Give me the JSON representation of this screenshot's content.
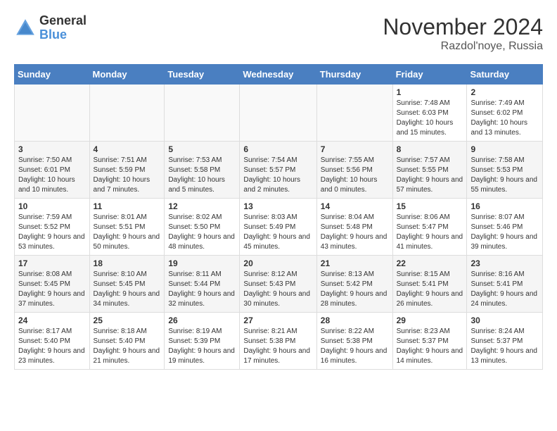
{
  "logo": {
    "general": "General",
    "blue": "Blue"
  },
  "title": "November 2024",
  "location": "Razdol'noye, Russia",
  "days_of_week": [
    "Sunday",
    "Monday",
    "Tuesday",
    "Wednesday",
    "Thursday",
    "Friday",
    "Saturday"
  ],
  "weeks": [
    [
      null,
      null,
      null,
      null,
      null,
      {
        "day": "1",
        "sunrise": "Sunrise: 7:48 AM",
        "sunset": "Sunset: 6:03 PM",
        "daylight": "Daylight: 10 hours and 15 minutes."
      },
      {
        "day": "2",
        "sunrise": "Sunrise: 7:49 AM",
        "sunset": "Sunset: 6:02 PM",
        "daylight": "Daylight: 10 hours and 13 minutes."
      }
    ],
    [
      {
        "day": "3",
        "sunrise": "Sunrise: 7:50 AM",
        "sunset": "Sunset: 6:01 PM",
        "daylight": "Daylight: 10 hours and 10 minutes."
      },
      {
        "day": "4",
        "sunrise": "Sunrise: 7:51 AM",
        "sunset": "Sunset: 5:59 PM",
        "daylight": "Daylight: 10 hours and 7 minutes."
      },
      {
        "day": "5",
        "sunrise": "Sunrise: 7:53 AM",
        "sunset": "Sunset: 5:58 PM",
        "daylight": "Daylight: 10 hours and 5 minutes."
      },
      {
        "day": "6",
        "sunrise": "Sunrise: 7:54 AM",
        "sunset": "Sunset: 5:57 PM",
        "daylight": "Daylight: 10 hours and 2 minutes."
      },
      {
        "day": "7",
        "sunrise": "Sunrise: 7:55 AM",
        "sunset": "Sunset: 5:56 PM",
        "daylight": "Daylight: 10 hours and 0 minutes."
      },
      {
        "day": "8",
        "sunrise": "Sunrise: 7:57 AM",
        "sunset": "Sunset: 5:55 PM",
        "daylight": "Daylight: 9 hours and 57 minutes."
      },
      {
        "day": "9",
        "sunrise": "Sunrise: 7:58 AM",
        "sunset": "Sunset: 5:53 PM",
        "daylight": "Daylight: 9 hours and 55 minutes."
      }
    ],
    [
      {
        "day": "10",
        "sunrise": "Sunrise: 7:59 AM",
        "sunset": "Sunset: 5:52 PM",
        "daylight": "Daylight: 9 hours and 53 minutes."
      },
      {
        "day": "11",
        "sunrise": "Sunrise: 8:01 AM",
        "sunset": "Sunset: 5:51 PM",
        "daylight": "Daylight: 9 hours and 50 minutes."
      },
      {
        "day": "12",
        "sunrise": "Sunrise: 8:02 AM",
        "sunset": "Sunset: 5:50 PM",
        "daylight": "Daylight: 9 hours and 48 minutes."
      },
      {
        "day": "13",
        "sunrise": "Sunrise: 8:03 AM",
        "sunset": "Sunset: 5:49 PM",
        "daylight": "Daylight: 9 hours and 45 minutes."
      },
      {
        "day": "14",
        "sunrise": "Sunrise: 8:04 AM",
        "sunset": "Sunset: 5:48 PM",
        "daylight": "Daylight: 9 hours and 43 minutes."
      },
      {
        "day": "15",
        "sunrise": "Sunrise: 8:06 AM",
        "sunset": "Sunset: 5:47 PM",
        "daylight": "Daylight: 9 hours and 41 minutes."
      },
      {
        "day": "16",
        "sunrise": "Sunrise: 8:07 AM",
        "sunset": "Sunset: 5:46 PM",
        "daylight": "Daylight: 9 hours and 39 minutes."
      }
    ],
    [
      {
        "day": "17",
        "sunrise": "Sunrise: 8:08 AM",
        "sunset": "Sunset: 5:45 PM",
        "daylight": "Daylight: 9 hours and 37 minutes."
      },
      {
        "day": "18",
        "sunrise": "Sunrise: 8:10 AM",
        "sunset": "Sunset: 5:45 PM",
        "daylight": "Daylight: 9 hours and 34 minutes."
      },
      {
        "day": "19",
        "sunrise": "Sunrise: 8:11 AM",
        "sunset": "Sunset: 5:44 PM",
        "daylight": "Daylight: 9 hours and 32 minutes."
      },
      {
        "day": "20",
        "sunrise": "Sunrise: 8:12 AM",
        "sunset": "Sunset: 5:43 PM",
        "daylight": "Daylight: 9 hours and 30 minutes."
      },
      {
        "day": "21",
        "sunrise": "Sunrise: 8:13 AM",
        "sunset": "Sunset: 5:42 PM",
        "daylight": "Daylight: 9 hours and 28 minutes."
      },
      {
        "day": "22",
        "sunrise": "Sunrise: 8:15 AM",
        "sunset": "Sunset: 5:41 PM",
        "daylight": "Daylight: 9 hours and 26 minutes."
      },
      {
        "day": "23",
        "sunrise": "Sunrise: 8:16 AM",
        "sunset": "Sunset: 5:41 PM",
        "daylight": "Daylight: 9 hours and 24 minutes."
      }
    ],
    [
      {
        "day": "24",
        "sunrise": "Sunrise: 8:17 AM",
        "sunset": "Sunset: 5:40 PM",
        "daylight": "Daylight: 9 hours and 23 minutes."
      },
      {
        "day": "25",
        "sunrise": "Sunrise: 8:18 AM",
        "sunset": "Sunset: 5:40 PM",
        "daylight": "Daylight: 9 hours and 21 minutes."
      },
      {
        "day": "26",
        "sunrise": "Sunrise: 8:19 AM",
        "sunset": "Sunset: 5:39 PM",
        "daylight": "Daylight: 9 hours and 19 minutes."
      },
      {
        "day": "27",
        "sunrise": "Sunrise: 8:21 AM",
        "sunset": "Sunset: 5:38 PM",
        "daylight": "Daylight: 9 hours and 17 minutes."
      },
      {
        "day": "28",
        "sunrise": "Sunrise: 8:22 AM",
        "sunset": "Sunset: 5:38 PM",
        "daylight": "Daylight: 9 hours and 16 minutes."
      },
      {
        "day": "29",
        "sunrise": "Sunrise: 8:23 AM",
        "sunset": "Sunset: 5:37 PM",
        "daylight": "Daylight: 9 hours and 14 minutes."
      },
      {
        "day": "30",
        "sunrise": "Sunrise: 8:24 AM",
        "sunset": "Sunset: 5:37 PM",
        "daylight": "Daylight: 9 hours and 13 minutes."
      }
    ]
  ]
}
